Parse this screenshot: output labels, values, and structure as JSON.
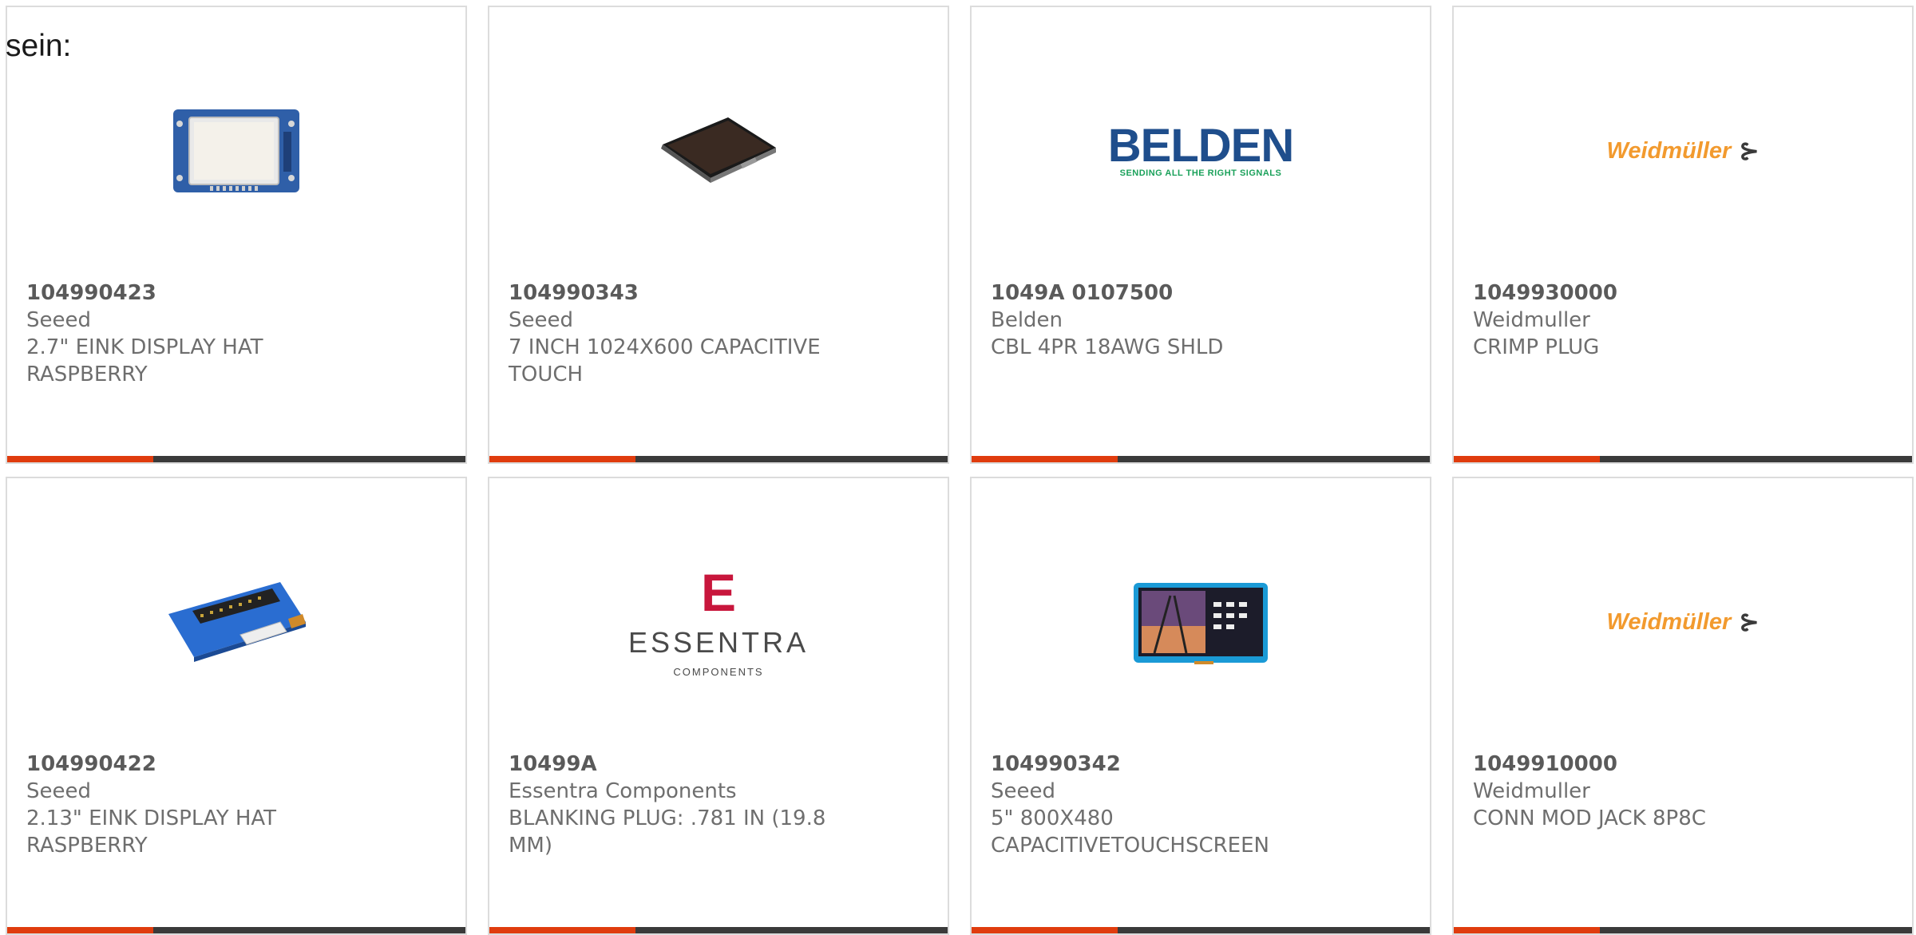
{
  "intro_text": "sein:",
  "colors": {
    "accent": "#e03c0e",
    "bar": "#3a3a3a",
    "border": "#dcdcdc"
  },
  "products": [
    {
      "part_number": "104990423",
      "brand": "Seeed",
      "desc_line1": "2.7\" EINK DISPLAY HAT",
      "desc_line2": "RASPBERRY",
      "image": "eink-display-hat-board"
    },
    {
      "part_number": "104990343",
      "brand": "Seeed",
      "desc_line1": "7 INCH 1024X600 CAPACITIVE",
      "desc_line2": "TOUCH",
      "image": "touch-display-panel"
    },
    {
      "part_number": "1049A 0107500",
      "brand": "Belden",
      "desc_line1": "CBL 4PR 18AWG SHLD",
      "desc_line2": "",
      "image": "belden-logo",
      "logo_text": "BELDEN",
      "logo_tagline": "SENDING ALL THE RIGHT SIGNALS"
    },
    {
      "part_number": "1049930000",
      "brand": "Weidmuller",
      "desc_line1": "CRIMP PLUG",
      "desc_line2": "",
      "image": "weidmuller-logo",
      "logo_text": "Weidmüller"
    },
    {
      "part_number": "104990422",
      "brand": "Seeed",
      "desc_line1": "2.13\" EINK DISPLAY HAT",
      "desc_line2": "RASPBERRY",
      "image": "eink-driver-board"
    },
    {
      "part_number": "10499A",
      "brand": "Essentra Components",
      "desc_line1": "BLANKING PLUG: .781 IN (19.8",
      "desc_line2": "MM)",
      "image": "essentra-logo",
      "logo_word": "ESSENTRA",
      "logo_sub": "COMPONENTS"
    },
    {
      "part_number": "104990342",
      "brand": "Seeed",
      "desc_line1": "5\" 800X480",
      "desc_line2": "CAPACITIVETOUCHSCREEN",
      "image": "capacitive-touchscreen"
    },
    {
      "part_number": "1049910000",
      "brand": "Weidmuller",
      "desc_line1": "CONN MOD JACK 8P8C",
      "desc_line2": "",
      "image": "weidmuller-logo",
      "logo_text": "Weidmüller"
    }
  ]
}
